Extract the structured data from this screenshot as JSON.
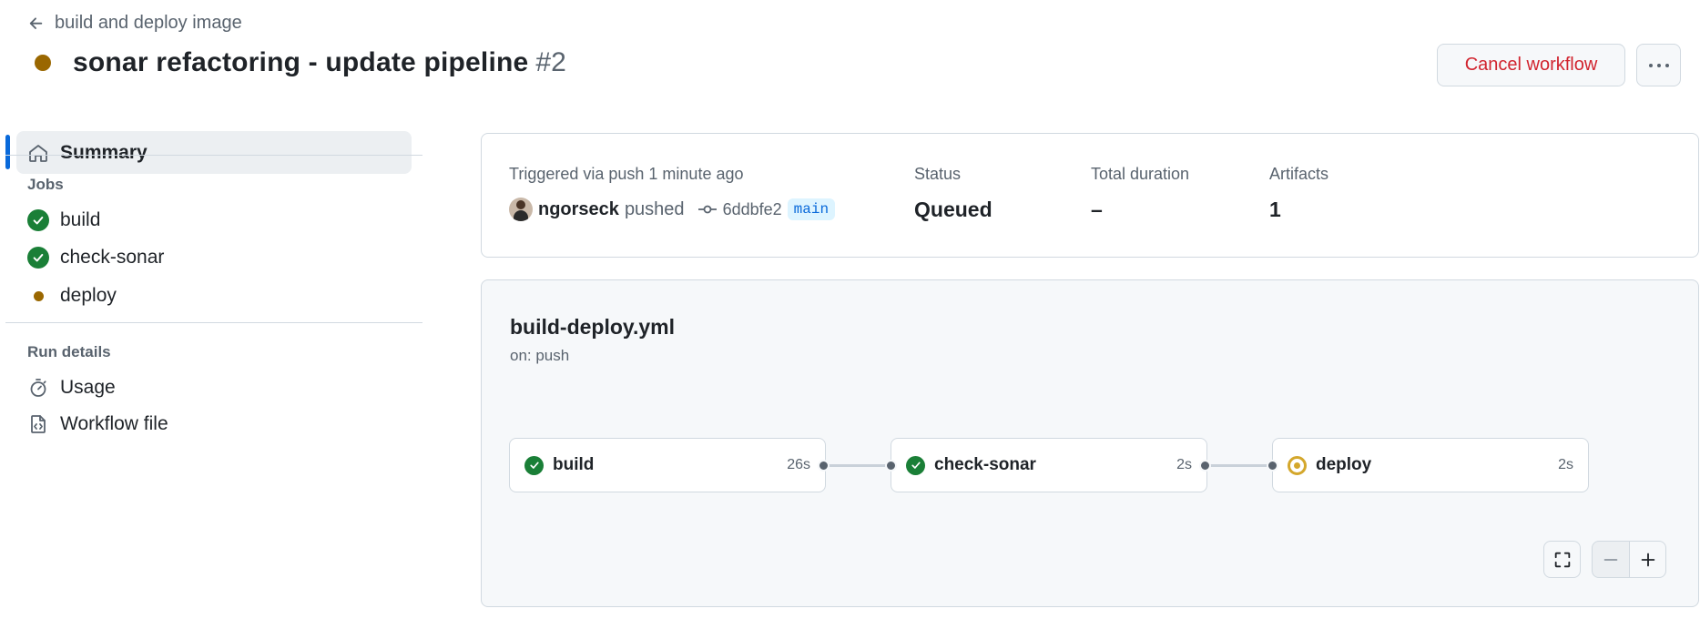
{
  "header": {
    "back_label": "build and deploy image",
    "title": "sonar refactoring - update pipeline",
    "run_number": "#2",
    "cancel_label": "Cancel workflow",
    "status_color": "#9a6700"
  },
  "sidebar": {
    "summary_label": "Summary",
    "jobs_heading": "Jobs",
    "jobs": [
      {
        "label": "build",
        "status": "success"
      },
      {
        "label": "check-sonar",
        "status": "success"
      },
      {
        "label": "deploy",
        "status": "queued"
      }
    ],
    "run_details_heading": "Run details",
    "details": [
      {
        "label": "Usage",
        "icon": "stopwatch-icon"
      },
      {
        "label": "Workflow file",
        "icon": "file-code-icon"
      }
    ]
  },
  "summary": {
    "trigger_label": "Triggered via push 1 minute ago",
    "user": "ngorseck",
    "action": "pushed",
    "commit_sha": "6ddbfe2",
    "branch": "main",
    "status_label": "Status",
    "status_value": "Queued",
    "duration_label": "Total duration",
    "duration_value": "–",
    "artifacts_label": "Artifacts",
    "artifacts_value": "1"
  },
  "graph": {
    "workflow_file": "build-deploy.yml",
    "trigger": "on: push",
    "jobs": [
      {
        "label": "build",
        "duration": "26s",
        "status": "success"
      },
      {
        "label": "check-sonar",
        "duration": "2s",
        "status": "success"
      },
      {
        "label": "deploy",
        "duration": "2s",
        "status": "queued"
      }
    ]
  },
  "colors": {
    "success": "#1a7f37",
    "queued": "#d4a72c",
    "danger": "#d1242f",
    "accent": "#0969da"
  }
}
